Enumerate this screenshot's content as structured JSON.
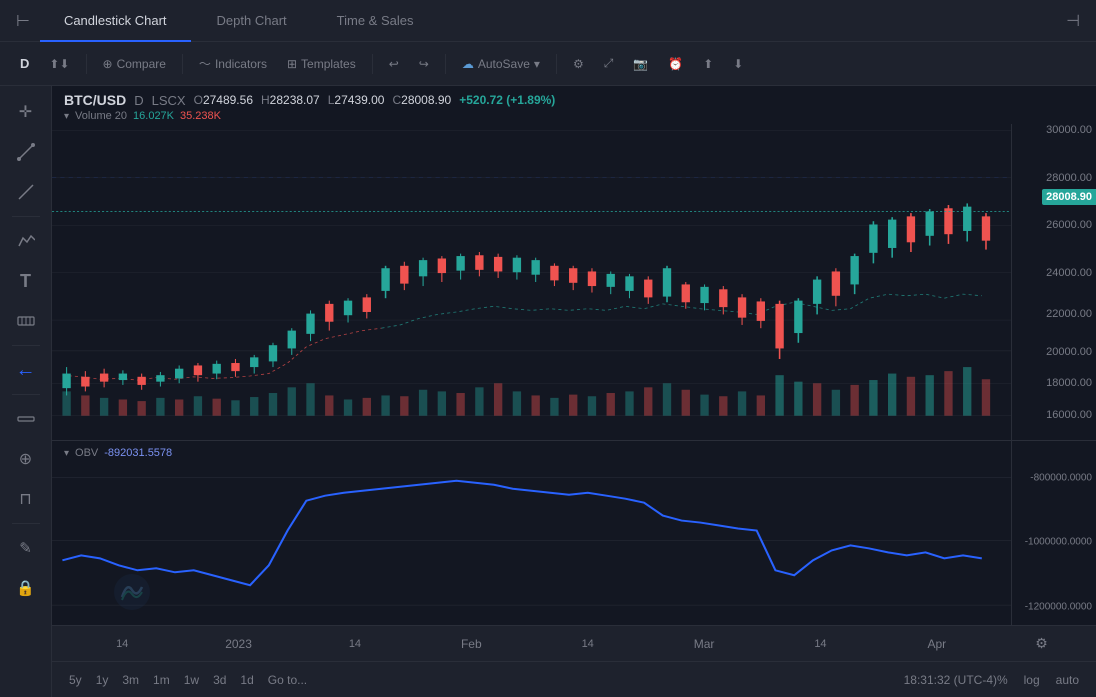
{
  "tabs": {
    "candlestick": "Candlestick Chart",
    "depth": "Depth Chart",
    "timesales": "Time & Sales",
    "active": "candlestick"
  },
  "toolbar": {
    "period": "D",
    "compare": "Compare",
    "indicators": "Indicators",
    "templates": "Templates",
    "autosave": "AutoSave",
    "undo_icon": "↩",
    "redo_icon": "↪"
  },
  "priceInfo": {
    "symbol": "BTC/USD",
    "period": "D",
    "exchange": "LSCX",
    "open_label": "O",
    "open": "27489.56",
    "high_label": "H",
    "high": "28238.07",
    "low_label": "L",
    "low": "27439.00",
    "close_label": "C",
    "close": "28008.90",
    "change": "+520.72 (+1.89%)",
    "volume_label": "Volume",
    "volume_period": "20",
    "volume_val1": "16.027K",
    "volume_val2": "35.238K"
  },
  "currentPrice": "28008.90",
  "priceAxisLabels": [
    {
      "value": "30000.00",
      "pct": 2
    },
    {
      "value": "28000.00",
      "pct": 17
    },
    {
      "value": "26000.00",
      "pct": 32
    },
    {
      "value": "24000.00",
      "pct": 47
    },
    {
      "value": "22000.00",
      "pct": 62
    },
    {
      "value": "20000.00",
      "pct": 72
    },
    {
      "value": "18000.00",
      "pct": 82
    },
    {
      "value": "16000.00",
      "pct": 92
    }
  ],
  "obvAxisLabels": [
    {
      "value": "-800000.0000",
      "pct": 20
    },
    {
      "value": "-1000000.0000",
      "pct": 55
    },
    {
      "value": "-1200000.0000",
      "pct": 90
    }
  ],
  "obv": {
    "label": "OBV",
    "value": "-892031.5578"
  },
  "timeLabels": [
    "14",
    "2023",
    "14",
    "Feb",
    "14",
    "Mar",
    "14",
    "Apr"
  ],
  "bottomPeriods": [
    "5y",
    "1y",
    "3m",
    "1m",
    "1w",
    "3d",
    "1d"
  ],
  "gotoLabel": "Go to...",
  "timestamp": "18:31:32 (UTC-4)",
  "bottomRight": {
    "percent": "%",
    "log": "log",
    "auto": "auto"
  },
  "leftTools": [
    "✛",
    "↗",
    "╱",
    "✂",
    "T",
    "⋮⋮",
    "←",
    "✏",
    "⊕",
    "⊓",
    "✎",
    "🔒"
  ]
}
